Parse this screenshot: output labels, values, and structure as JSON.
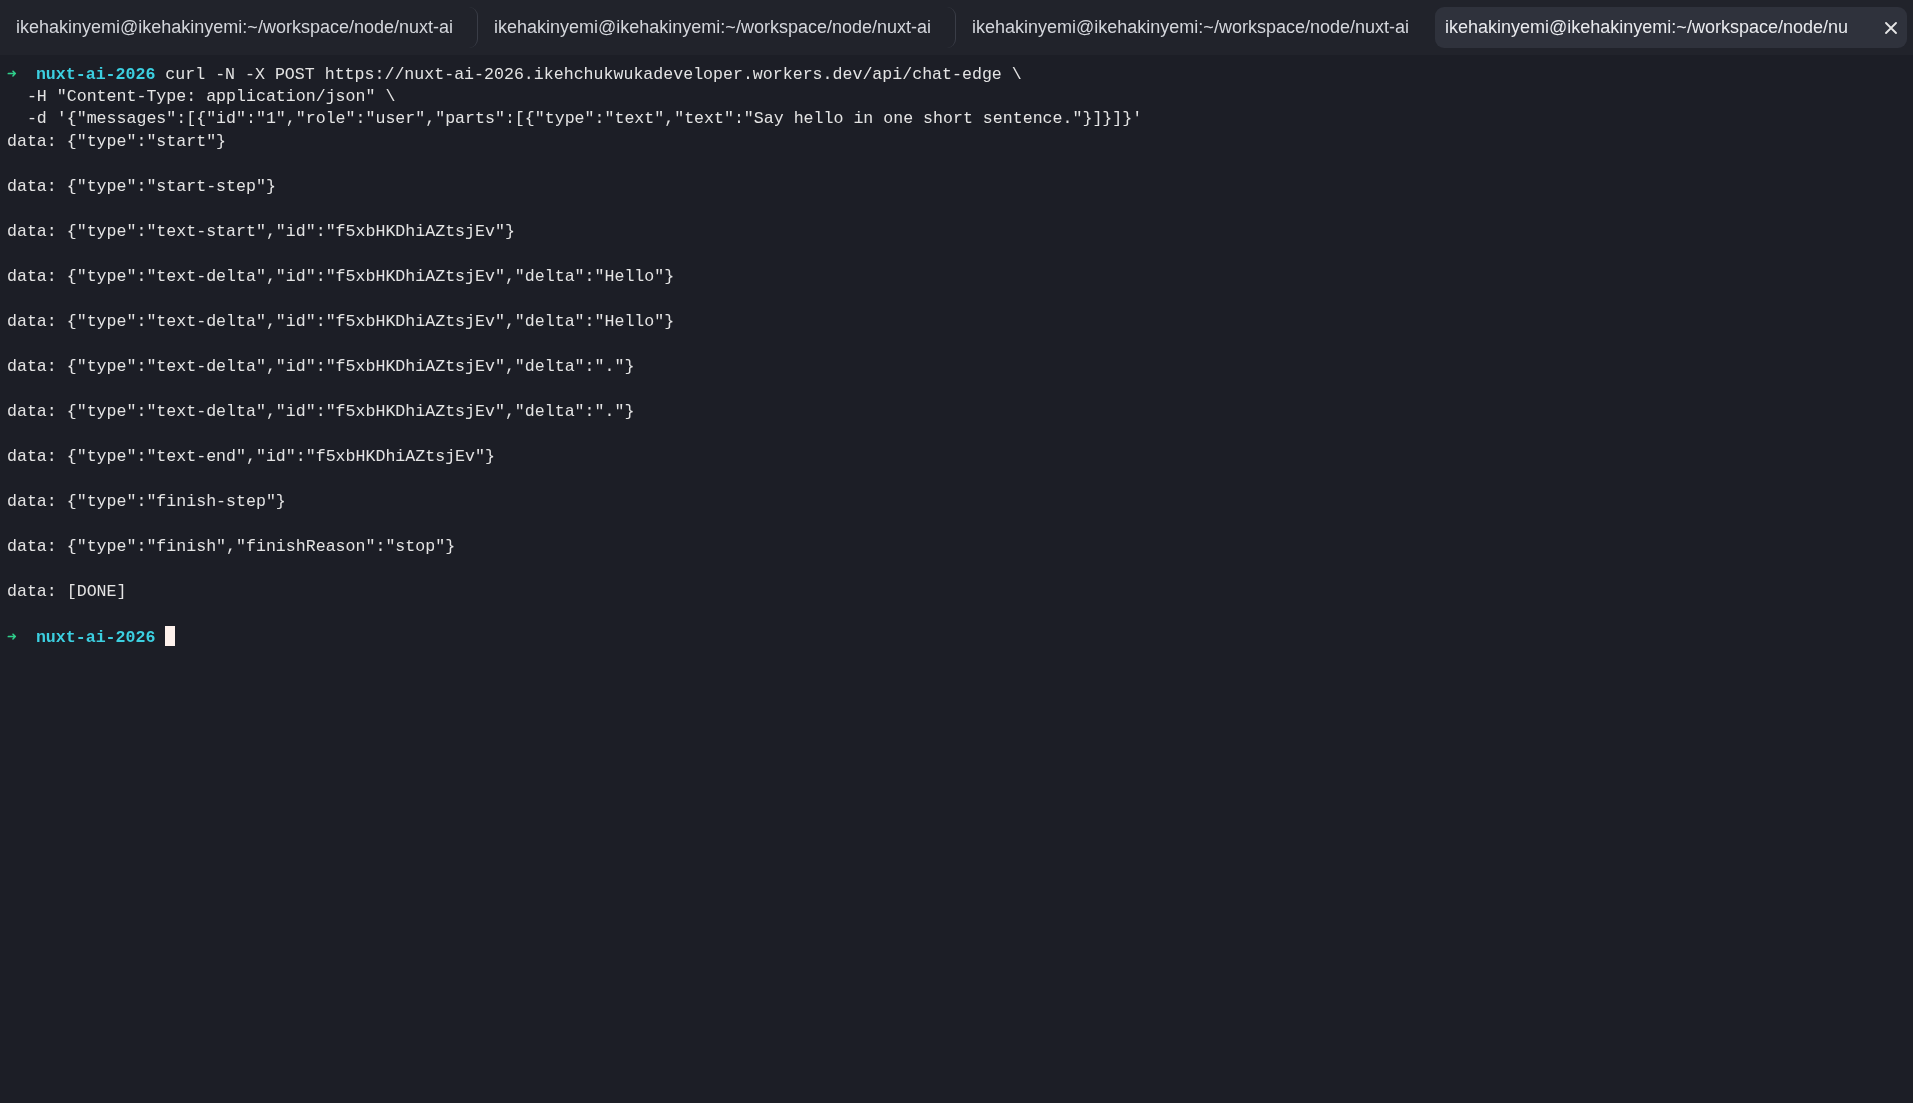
{
  "tabs": [
    {
      "label": "ikehakinyemi@ikehakinyemi:~/workspace/node/nuxt-ai",
      "selected": false
    },
    {
      "label": "ikehakinyemi@ikehakinyemi:~/workspace/node/nuxt-ai",
      "selected": false
    },
    {
      "label": "ikehakinyemi@ikehakinyemi:~/workspace/node/nuxt-ai",
      "selected": false
    },
    {
      "label": "ikehakinyemi@ikehakinyemi:~/workspace/node/nu",
      "selected": true
    }
  ],
  "terminal": {
    "lines": [
      {
        "kind": "command",
        "prompt": "➜",
        "directory": "nuxt-ai-2026",
        "text": "curl -N -X POST https://nuxt-ai-2026.ikehchukwukadeveloper.workers.dev/api/chat-edge \\"
      },
      {
        "kind": "continuation",
        "text": "-H \"Content-Type: application/json\" \\"
      },
      {
        "kind": "continuation",
        "text": "-d '{\"messages\":[{\"id\":\"1\",\"role\":\"user\",\"parts\":[{\"type\":\"text\",\"text\":\"Say hello in one short sentence.\"}]}]}'"
      },
      {
        "kind": "output",
        "text": "data: {\"type\":\"start\"}"
      },
      {
        "kind": "blank"
      },
      {
        "kind": "output",
        "text": "data: {\"type\":\"start-step\"}"
      },
      {
        "kind": "blank"
      },
      {
        "kind": "output",
        "text": "data: {\"type\":\"text-start\",\"id\":\"f5xbHKDhiAZtsjEv\"}"
      },
      {
        "kind": "blank"
      },
      {
        "kind": "output",
        "text": "data: {\"type\":\"text-delta\",\"id\":\"f5xbHKDhiAZtsjEv\",\"delta\":\"Hello\"}"
      },
      {
        "kind": "blank"
      },
      {
        "kind": "output",
        "text": "data: {\"type\":\"text-delta\",\"id\":\"f5xbHKDhiAZtsjEv\",\"delta\":\"Hello\"}"
      },
      {
        "kind": "blank"
      },
      {
        "kind": "output",
        "text": "data: {\"type\":\"text-delta\",\"id\":\"f5xbHKDhiAZtsjEv\",\"delta\":\".\"}"
      },
      {
        "kind": "blank"
      },
      {
        "kind": "output",
        "text": "data: {\"type\":\"text-delta\",\"id\":\"f5xbHKDhiAZtsjEv\",\"delta\":\".\"}"
      },
      {
        "kind": "blank"
      },
      {
        "kind": "output",
        "text": "data: {\"type\":\"text-end\",\"id\":\"f5xbHKDhiAZtsjEv\"}"
      },
      {
        "kind": "blank"
      },
      {
        "kind": "output",
        "text": "data: {\"type\":\"finish-step\"}"
      },
      {
        "kind": "blank"
      },
      {
        "kind": "output",
        "text": "data: {\"type\":\"finish\",\"finishReason\":\"stop\"}"
      },
      {
        "kind": "blank"
      },
      {
        "kind": "output",
        "text": "data: [DONE]"
      },
      {
        "kind": "blank"
      },
      {
        "kind": "prompt",
        "prompt": "➜",
        "directory": "nuxt-ai-2026",
        "cursor": true
      }
    ]
  }
}
